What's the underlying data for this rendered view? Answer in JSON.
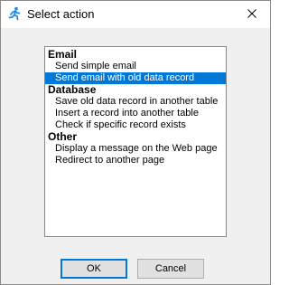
{
  "window": {
    "title": "Select action",
    "app_icon": "running-figure-icon",
    "close_icon": "close-icon"
  },
  "actions": {
    "groups": [
      {
        "header": "Email",
        "items": [
          {
            "label": "Send simple email",
            "selected": false
          },
          {
            "label": "Send email with old data record",
            "selected": true
          }
        ]
      },
      {
        "header": "Database",
        "items": [
          {
            "label": "Save old data record in another table",
            "selected": false
          },
          {
            "label": "Insert a record into another table",
            "selected": false
          },
          {
            "label": "Check if specific record exists",
            "selected": false
          }
        ]
      },
      {
        "header": "Other",
        "items": [
          {
            "label": "Display a message on the Web page",
            "selected": false
          },
          {
            "label": "Redirect to another page",
            "selected": false
          }
        ]
      }
    ]
  },
  "buttons": {
    "ok_label": "OK",
    "cancel_label": "Cancel"
  },
  "colors": {
    "selection": "#0078d7",
    "app_icon": "#1e88e5"
  }
}
